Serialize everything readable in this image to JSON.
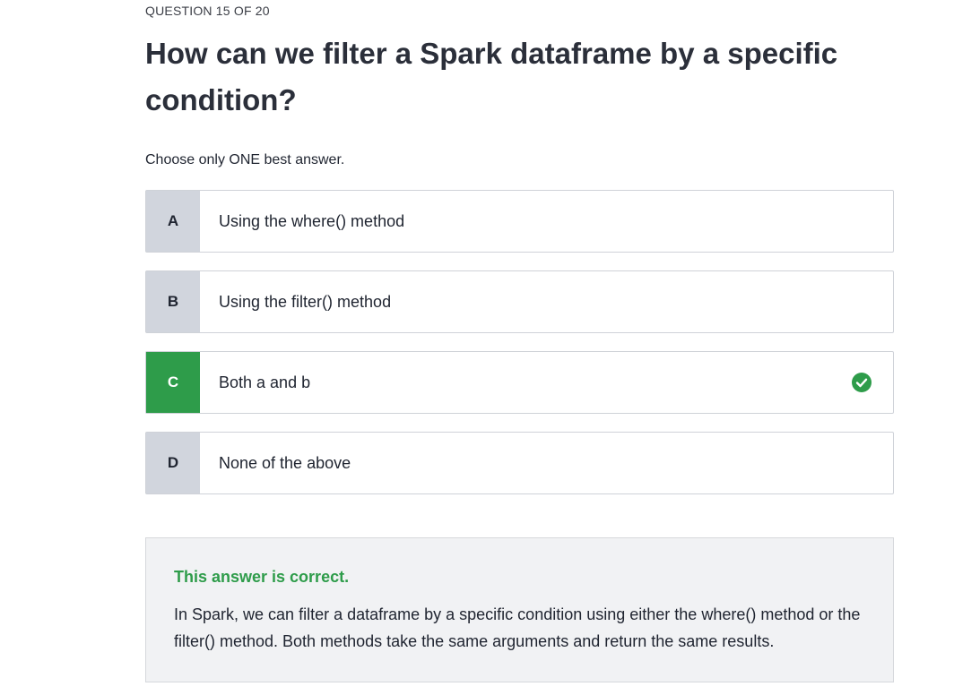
{
  "question": {
    "counter": "QUESTION 15 OF 20",
    "title": "How can we filter a Spark dataframe by a specific condition?",
    "instruction": "Choose only ONE best answer."
  },
  "options": [
    {
      "letter": "A",
      "text": "Using the where() method",
      "state": "default"
    },
    {
      "letter": "B",
      "text": "Using the filter() method",
      "state": "default"
    },
    {
      "letter": "C",
      "text": "Both a and b",
      "state": "correct",
      "icon": "check-circle-icon"
    },
    {
      "letter": "D",
      "text": "None of the above",
      "state": "default"
    }
  ],
  "feedback": {
    "title": "This answer is correct.",
    "text": "In Spark, we can filter a dataframe by a specific condition using either the where() method or the filter() method. Both methods take the same arguments and return the same results."
  },
  "colors": {
    "correct": "#2e9c4a",
    "letter_bg": "#d1d5dd",
    "feedback_bg": "#f1f2f4"
  }
}
